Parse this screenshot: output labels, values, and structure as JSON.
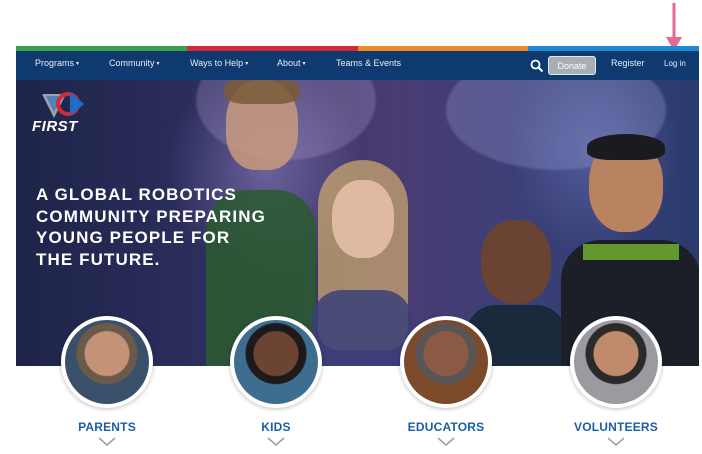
{
  "nav": {
    "strip_colors": [
      "#3aa14b",
      "#d12b3a",
      "#ec8a2c",
      "#1f8ad0"
    ],
    "items": [
      {
        "label": "Programs",
        "caret": "▾"
      },
      {
        "label": "Community",
        "caret": "▾"
      },
      {
        "label": "Ways to Help",
        "caret": "▾"
      },
      {
        "label": "About",
        "caret": "▾"
      },
      {
        "label": "Teams & Events",
        "caret": ""
      }
    ],
    "search_icon": "search-icon",
    "donate_label": "Donate",
    "register_label": "Register",
    "login_label": "Log in",
    "bar_color": "#0e3a70"
  },
  "annotation": {
    "icon": "arrow-down-icon",
    "color": "#e86a8e"
  },
  "brand": {
    "name": "FIRST",
    "colors": [
      "#d12b3a",
      "#1f6cc2",
      "#9aa3ad"
    ]
  },
  "hero": {
    "headline_lines": [
      "A GLOBAL ROBOTICS",
      "COMMUNITY PREPARING",
      "YOUNG PEOPLE FOR",
      "THE FUTURE."
    ]
  },
  "audiences": [
    {
      "label": "PARENTS",
      "icon": "chevron-down-icon"
    },
    {
      "label": "KIDS",
      "icon": "chevron-down-icon"
    },
    {
      "label": "EDUCATORS",
      "icon": "chevron-down-icon"
    },
    {
      "label": "VOLUNTEERS",
      "icon": "chevron-down-icon"
    }
  ],
  "accent_color": "#1b5fa6"
}
